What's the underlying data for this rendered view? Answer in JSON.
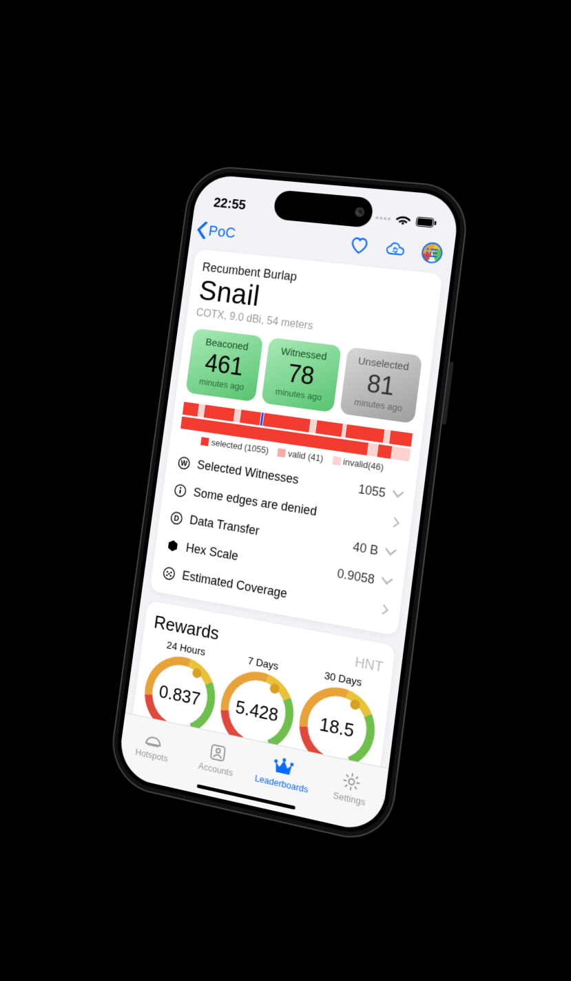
{
  "status": {
    "time": "22:55"
  },
  "nav": {
    "back_label": "PoC"
  },
  "hotspot": {
    "subtitle": "Recumbent Burlap",
    "title": "Snail",
    "meta": "COTX, 9.0 dBi, 54 meters",
    "tiles": [
      {
        "label": "Beaconed",
        "value": "461",
        "sub": "minutes ago",
        "style": "green"
      },
      {
        "label": "Witnessed",
        "value": "78",
        "sub": "minutes ago",
        "style": "green"
      },
      {
        "label": "Unselected",
        "value": "81",
        "sub": "minutes ago",
        "style": "grey"
      }
    ],
    "legend": {
      "selected": "selected (1055)",
      "valid": "valid (41)",
      "invalid": "invalid(46)"
    },
    "rows": [
      {
        "icon": "w-circle",
        "label": "Selected Witnesses",
        "value": "1055"
      },
      {
        "icon": "info",
        "label": "Some edges are denied",
        "value": ""
      },
      {
        "icon": "d-circle",
        "label": "Data Transfer",
        "value": "40 B"
      },
      {
        "icon": "hex",
        "label": "Hex Scale",
        "value": "0.9058"
      },
      {
        "icon": "dots",
        "label": "Estimated Coverage",
        "value": ""
      }
    ]
  },
  "rewards": {
    "title": "Rewards",
    "unit": "HNT",
    "gauges": [
      {
        "label": "24 Hours",
        "value": "0.837"
      },
      {
        "label": "7 Days",
        "value": "5.428"
      },
      {
        "label": "30 Days",
        "value": "18.5"
      }
    ]
  },
  "tabs": {
    "hotspots": "Hotspots",
    "accounts": "Accounts",
    "leaderboards": "Leaderboards",
    "settings": "Settings"
  },
  "colors": {
    "accent": "#0a6cff"
  }
}
